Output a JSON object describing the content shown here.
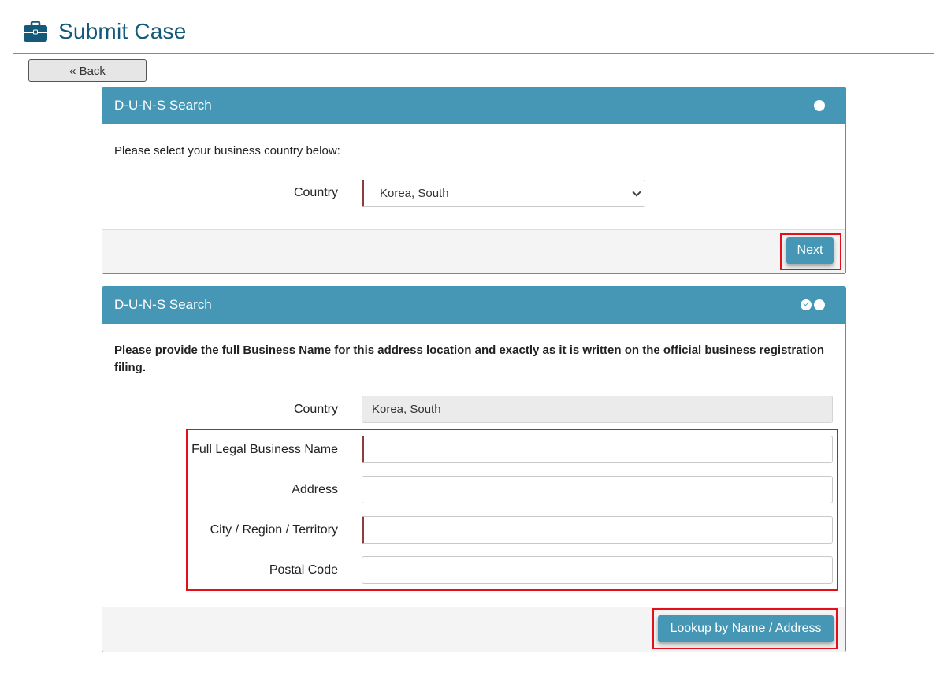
{
  "header": {
    "icon": "briefcase-icon",
    "title": "Submit Case"
  },
  "back_button": {
    "label": "« Back"
  },
  "panel1": {
    "title": "D-U-N-S Search",
    "step_dots": [
      "circle"
    ],
    "instructions": "Please select your business country below:",
    "country_label": "Country",
    "country_value": "Korea, South",
    "next_label": "Next"
  },
  "panel2": {
    "title": "D-U-N-S Search",
    "step_dots": [
      "check-circle",
      "circle"
    ],
    "instructions": "Please provide the full Business Name for this address location and exactly as it is written on the official business registration filing.",
    "country_label": "Country",
    "country_value": "Korea, South",
    "fields": [
      {
        "label": "Full Legal Business Name",
        "value": "",
        "required": true
      },
      {
        "label": "Address",
        "value": "",
        "required": false
      },
      {
        "label": "City / Region / Territory",
        "value": "",
        "required": true
      },
      {
        "label": "Postal Code",
        "value": "",
        "required": false
      }
    ],
    "lookup_label": "Lookup by Name / Address"
  },
  "colors": {
    "accent": "#4597b5",
    "title": "#14587a",
    "required_marker": "#8c3d3d",
    "highlight": "#e3101a"
  }
}
